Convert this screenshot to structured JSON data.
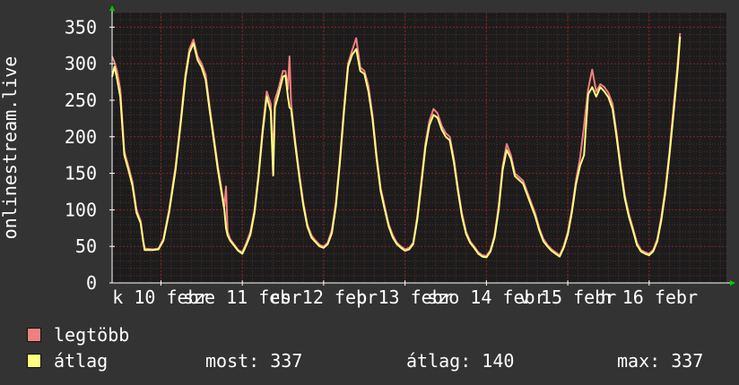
{
  "colors": {
    "background": "#333333",
    "plot_background": "#1c1c1c",
    "grid_minor": "#5a2a2a",
    "grid_major": "#8a2222",
    "axis": "#ffffff",
    "max_series": "#f08080",
    "avg_series": "#ffff80",
    "arrow": "#00cc00"
  },
  "chart_data": {
    "type": "line",
    "ylabel": "onlinestream.live",
    "ylim": [
      0,
      370
    ],
    "yticks": [
      0,
      50,
      100,
      150,
      200,
      250,
      300,
      350
    ],
    "xlim": [
      -0.6,
      6.95
    ],
    "xticks": [
      {
        "x": 0,
        "label": "k 10 febr"
      },
      {
        "x": 1,
        "label": "sze 11 febr"
      },
      {
        "x": 2,
        "label": "cs 12 febr"
      },
      {
        "x": 3,
        "label": "p 13 febr"
      },
      {
        "x": 4,
        "label": "szo 14 febr"
      },
      {
        "x": 5,
        "label": "v 15 febr"
      },
      {
        "x": 6,
        "label": "h 16 febr"
      }
    ],
    "grid": true,
    "series": [
      {
        "name": "legtöbb",
        "points": [
          [
            -0.6,
            310
          ],
          [
            -0.57,
            302
          ],
          [
            -0.54,
            290
          ],
          [
            -0.5,
            265
          ],
          [
            -0.45,
            180
          ],
          [
            -0.4,
            160
          ],
          [
            -0.35,
            138
          ],
          [
            -0.3,
            100
          ],
          [
            -0.25,
            85
          ],
          [
            -0.22,
            60
          ],
          [
            -0.2,
            47
          ],
          [
            -0.1,
            46
          ],
          [
            -0.03,
            47
          ],
          [
            0.03,
            60
          ],
          [
            0.1,
            100
          ],
          [
            0.18,
            160
          ],
          [
            0.25,
            230
          ],
          [
            0.3,
            285
          ],
          [
            0.35,
            320
          ],
          [
            0.4,
            333
          ],
          [
            0.45,
            310
          ],
          [
            0.5,
            300
          ],
          [
            0.55,
            285
          ],
          [
            0.6,
            240
          ],
          [
            0.65,
            200
          ],
          [
            0.7,
            160
          ],
          [
            0.75,
            125
          ],
          [
            0.78,
            105
          ],
          [
            0.8,
            132
          ],
          [
            0.82,
            70
          ],
          [
            0.85,
            60
          ],
          [
            0.95,
            45
          ],
          [
            1.0,
            42
          ],
          [
            1.05,
            55
          ],
          [
            1.1,
            70
          ],
          [
            1.15,
            100
          ],
          [
            1.2,
            150
          ],
          [
            1.25,
            210
          ],
          [
            1.3,
            262
          ],
          [
            1.35,
            245
          ],
          [
            1.38,
            170
          ],
          [
            1.4,
            250
          ],
          [
            1.45,
            268
          ],
          [
            1.5,
            290
          ],
          [
            1.53,
            290
          ],
          [
            1.56,
            265
          ],
          [
            1.58,
            310
          ],
          [
            1.6,
            245
          ],
          [
            1.65,
            195
          ],
          [
            1.7,
            150
          ],
          [
            1.75,
            110
          ],
          [
            1.8,
            80
          ],
          [
            1.85,
            65
          ],
          [
            1.9,
            58
          ],
          [
            1.95,
            52
          ],
          [
            2.0,
            50
          ],
          [
            2.05,
            55
          ],
          [
            2.1,
            72
          ],
          [
            2.15,
            110
          ],
          [
            2.2,
            170
          ],
          [
            2.25,
            240
          ],
          [
            2.3,
            300
          ],
          [
            2.35,
            318
          ],
          [
            2.4,
            335
          ],
          [
            2.45,
            295
          ],
          [
            2.5,
            290
          ],
          [
            2.55,
            270
          ],
          [
            2.6,
            230
          ],
          [
            2.65,
            175
          ],
          [
            2.7,
            130
          ],
          [
            2.75,
            105
          ],
          [
            2.8,
            80
          ],
          [
            2.85,
            65
          ],
          [
            2.9,
            55
          ],
          [
            2.95,
            50
          ],
          [
            3.0,
            46
          ],
          [
            3.05,
            48
          ],
          [
            3.1,
            55
          ],
          [
            3.15,
            90
          ],
          [
            3.2,
            140
          ],
          [
            3.25,
            190
          ],
          [
            3.3,
            222
          ],
          [
            3.35,
            238
          ],
          [
            3.4,
            232
          ],
          [
            3.45,
            215
          ],
          [
            3.5,
            205
          ],
          [
            3.55,
            200
          ],
          [
            3.6,
            170
          ],
          [
            3.65,
            130
          ],
          [
            3.7,
            95
          ],
          [
            3.75,
            70
          ],
          [
            3.8,
            57
          ],
          [
            3.85,
            50
          ],
          [
            3.9,
            42
          ],
          [
            3.95,
            38
          ],
          [
            4.0,
            37
          ],
          [
            4.05,
            45
          ],
          [
            4.1,
            65
          ],
          [
            4.15,
            105
          ],
          [
            4.2,
            160
          ],
          [
            4.25,
            190
          ],
          [
            4.3,
            175
          ],
          [
            4.35,
            150
          ],
          [
            4.4,
            145
          ],
          [
            4.45,
            140
          ],
          [
            4.5,
            125
          ],
          [
            4.55,
            110
          ],
          [
            4.6,
            95
          ],
          [
            4.65,
            75
          ],
          [
            4.7,
            60
          ],
          [
            4.75,
            52
          ],
          [
            4.8,
            46
          ],
          [
            4.85,
            42
          ],
          [
            4.9,
            38
          ],
          [
            4.95,
            50
          ],
          [
            5.0,
            70
          ],
          [
            5.05,
            100
          ],
          [
            5.1,
            140
          ],
          [
            5.15,
            170
          ],
          [
            5.2,
            215
          ],
          [
            5.25,
            265
          ],
          [
            5.3,
            292
          ],
          [
            5.35,
            262
          ],
          [
            5.4,
            272
          ],
          [
            5.45,
            268
          ],
          [
            5.5,
            260
          ],
          [
            5.55,
            245
          ],
          [
            5.6,
            205
          ],
          [
            5.65,
            160
          ],
          [
            5.7,
            120
          ],
          [
            5.75,
            95
          ],
          [
            5.8,
            75
          ],
          [
            5.85,
            55
          ],
          [
            5.9,
            45
          ],
          [
            5.95,
            42
          ],
          [
            6.0,
            40
          ],
          [
            6.05,
            45
          ],
          [
            6.1,
            60
          ],
          [
            6.15,
            90
          ],
          [
            6.2,
            130
          ],
          [
            6.25,
            180
          ],
          [
            6.3,
            240
          ],
          [
            6.35,
            300
          ],
          [
            6.38,
            342
          ]
        ]
      },
      {
        "name": "átlag",
        "points": [
          [
            -0.6,
            282
          ],
          [
            -0.57,
            296
          ],
          [
            -0.54,
            280
          ],
          [
            -0.5,
            255
          ],
          [
            -0.45,
            175
          ],
          [
            -0.4,
            155
          ],
          [
            -0.35,
            133
          ],
          [
            -0.3,
            96
          ],
          [
            -0.25,
            82
          ],
          [
            -0.22,
            58
          ],
          [
            -0.2,
            45
          ],
          [
            -0.1,
            45
          ],
          [
            -0.03,
            46
          ],
          [
            0.03,
            58
          ],
          [
            0.1,
            96
          ],
          [
            0.18,
            155
          ],
          [
            0.25,
            225
          ],
          [
            0.3,
            280
          ],
          [
            0.35,
            315
          ],
          [
            0.4,
            328
          ],
          [
            0.45,
            305
          ],
          [
            0.5,
            295
          ],
          [
            0.55,
            278
          ],
          [
            0.6,
            235
          ],
          [
            0.65,
            195
          ],
          [
            0.7,
            155
          ],
          [
            0.75,
            120
          ],
          [
            0.78,
            100
          ],
          [
            0.8,
            75
          ],
          [
            0.82,
            65
          ],
          [
            0.85,
            58
          ],
          [
            0.95,
            44
          ],
          [
            1.0,
            40
          ],
          [
            1.05,
            52
          ],
          [
            1.1,
            66
          ],
          [
            1.15,
            96
          ],
          [
            1.2,
            145
          ],
          [
            1.25,
            205
          ],
          [
            1.3,
            255
          ],
          [
            1.35,
            235
          ],
          [
            1.38,
            147
          ],
          [
            1.4,
            240
          ],
          [
            1.45,
            260
          ],
          [
            1.5,
            282
          ],
          [
            1.53,
            284
          ],
          [
            1.56,
            255
          ],
          [
            1.58,
            240
          ],
          [
            1.6,
            238
          ],
          [
            1.65,
            190
          ],
          [
            1.7,
            145
          ],
          [
            1.75,
            106
          ],
          [
            1.8,
            77
          ],
          [
            1.85,
            62
          ],
          [
            1.9,
            56
          ],
          [
            1.95,
            50
          ],
          [
            2.0,
            48
          ],
          [
            2.05,
            53
          ],
          [
            2.1,
            68
          ],
          [
            2.15,
            105
          ],
          [
            2.2,
            165
          ],
          [
            2.25,
            235
          ],
          [
            2.3,
            296
          ],
          [
            2.35,
            312
          ],
          [
            2.4,
            320
          ],
          [
            2.45,
            290
          ],
          [
            2.5,
            286
          ],
          [
            2.55,
            262
          ],
          [
            2.6,
            225
          ],
          [
            2.65,
            170
          ],
          [
            2.7,
            126
          ],
          [
            2.75,
            101
          ],
          [
            2.8,
            77
          ],
          [
            2.85,
            62
          ],
          [
            2.9,
            53
          ],
          [
            2.95,
            48
          ],
          [
            3.0,
            44
          ],
          [
            3.05,
            46
          ],
          [
            3.1,
            53
          ],
          [
            3.15,
            86
          ],
          [
            3.2,
            135
          ],
          [
            3.25,
            185
          ],
          [
            3.3,
            216
          ],
          [
            3.35,
            230
          ],
          [
            3.4,
            226
          ],
          [
            3.45,
            210
          ],
          [
            3.5,
            200
          ],
          [
            3.55,
            195
          ],
          [
            3.6,
            165
          ],
          [
            3.65,
            126
          ],
          [
            3.7,
            91
          ],
          [
            3.75,
            67
          ],
          [
            3.8,
            55
          ],
          [
            3.85,
            48
          ],
          [
            3.9,
            40
          ],
          [
            3.95,
            36
          ],
          [
            4.0,
            35
          ],
          [
            4.05,
            43
          ],
          [
            4.1,
            62
          ],
          [
            4.15,
            100
          ],
          [
            4.2,
            155
          ],
          [
            4.25,
            182
          ],
          [
            4.3,
            170
          ],
          [
            4.35,
            146
          ],
          [
            4.4,
            141
          ],
          [
            4.45,
            136
          ],
          [
            4.5,
            121
          ],
          [
            4.55,
            106
          ],
          [
            4.6,
            91
          ],
          [
            4.65,
            72
          ],
          [
            4.7,
            57
          ],
          [
            4.75,
            50
          ],
          [
            4.8,
            44
          ],
          [
            4.85,
            40
          ],
          [
            4.9,
            36
          ],
          [
            4.95,
            48
          ],
          [
            5.0,
            66
          ],
          [
            5.05,
            96
          ],
          [
            5.1,
            135
          ],
          [
            5.15,
            160
          ],
          [
            5.2,
            175
          ],
          [
            5.25,
            258
          ],
          [
            5.3,
            268
          ],
          [
            5.35,
            255
          ],
          [
            5.4,
            268
          ],
          [
            5.45,
            262
          ],
          [
            5.5,
            254
          ],
          [
            5.55,
            238
          ],
          [
            5.6,
            200
          ],
          [
            5.65,
            155
          ],
          [
            5.7,
            116
          ],
          [
            5.75,
            91
          ],
          [
            5.8,
            72
          ],
          [
            5.85,
            52
          ],
          [
            5.9,
            43
          ],
          [
            5.95,
            40
          ],
          [
            6.0,
            38
          ],
          [
            6.05,
            43
          ],
          [
            6.1,
            57
          ],
          [
            6.15,
            86
          ],
          [
            6.2,
            125
          ],
          [
            6.25,
            175
          ],
          [
            6.3,
            232
          ],
          [
            6.35,
            292
          ],
          [
            6.38,
            337
          ]
        ]
      }
    ]
  },
  "legend": {
    "max_label": "legtöbb",
    "avg_label": "átlag"
  },
  "stats": {
    "now": "most: 337",
    "avg": "átlag: 140",
    "max": "max: 337"
  }
}
